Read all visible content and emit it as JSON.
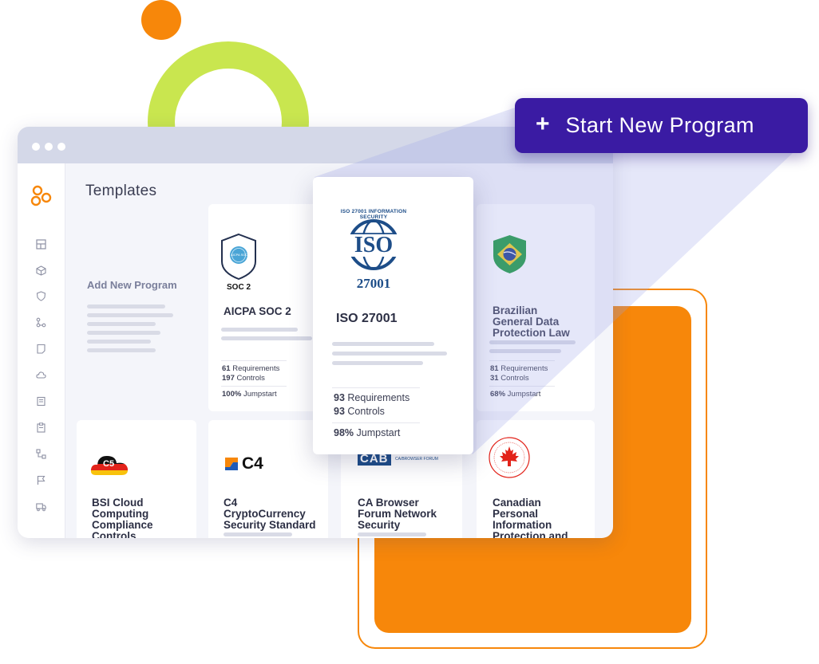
{
  "page": {
    "title": "Templates"
  },
  "cta": {
    "plus": "+",
    "label": "Start New Program"
  },
  "add_card": {
    "label": "Add New Program"
  },
  "soc2": {
    "badge": "SOC 2",
    "badge_inner": "AICPA SOC",
    "title": "AICPA SOC 2",
    "req_count": "61",
    "req_label": "Requirements",
    "ctrl_count": "197",
    "ctrl_label": "Controls",
    "jump_pct": "100%",
    "jump_label": "Jumpstart"
  },
  "iso": {
    "logo_ring": "ISO 27001 INFORMATION SECURITY",
    "logo_main": "ISO",
    "logo_num": "27001",
    "title": "ISO 27001",
    "req_count": "93",
    "req_label": "Requirements",
    "ctrl_count": "93",
    "ctrl_label": "Controls",
    "jump_pct": "98%",
    "jump_label": "Jumpstart"
  },
  "brazil": {
    "title_1": "Brazilian",
    "title_2": "General Data",
    "title_3": "Protection Law",
    "req_count": "81",
    "req_label": "Requirements",
    "ctrl_count": "31",
    "ctrl_label": "Controls",
    "jump_pct": "68%",
    "jump_label": "Jumpstart"
  },
  "bsi": {
    "logo": "C5",
    "title_1": "BSI Cloud",
    "title_2": "Computing",
    "title_3": "Compliance",
    "title_4": "Controls"
  },
  "c4": {
    "logo": "C4",
    "title_1": "C4",
    "title_2": "CryptoCurrency",
    "title_3": "Security Standard"
  },
  "cab": {
    "logo": "CAB",
    "logo_sub": "CA/BROWSER FORUM",
    "title_1": "CA Browser",
    "title_2": "Forum Network",
    "title_3": "Security"
  },
  "canada": {
    "title_1": "Canadian",
    "title_2": "Personal",
    "title_3": "Information",
    "title_4": "Protection and"
  },
  "sidebar": {
    "icons": [
      "grid-icon",
      "cube-icon",
      "shield-icon",
      "flow-icon",
      "bookmark-icon",
      "cloud-icon",
      "receipt-icon",
      "clipboard-icon",
      "network-icon",
      "flag-icon",
      "truck-icon"
    ]
  },
  "colors": {
    "brand_orange": "#f7870a",
    "accent_green": "#c9e64f",
    "cta_purple": "#3a1ba3"
  }
}
